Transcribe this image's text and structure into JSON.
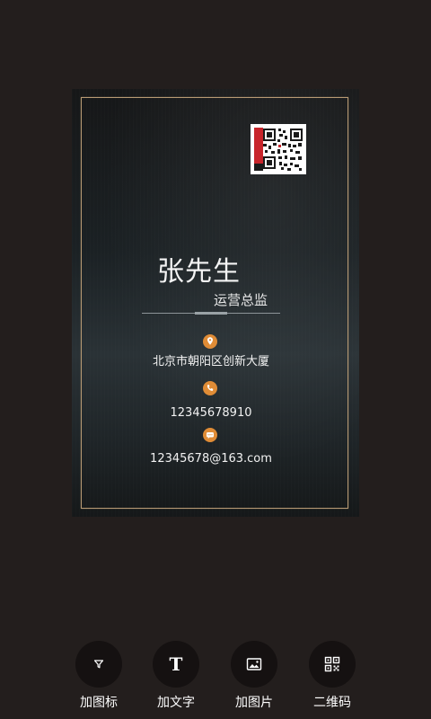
{
  "card": {
    "name": "张先生",
    "title": "运营总监",
    "address": "北京市朝阳区创新大厦",
    "phone": "12345678910",
    "email": "12345678@163.com",
    "icons": {
      "qr": "qr-code",
      "address": "location-pin-icon",
      "phone": "phone-icon",
      "email": "chat-bubble-icon"
    },
    "accent_color": "#e08c36",
    "frame_color": "#b79a74"
  },
  "toolbar": {
    "items": [
      {
        "label": "加图标",
        "icon": "funnel-icon"
      },
      {
        "label": "加文字",
        "icon": "text-icon"
      },
      {
        "label": "加图片",
        "icon": "image-icon"
      },
      {
        "label": "二维码",
        "icon": "qr-code-icon"
      }
    ]
  }
}
